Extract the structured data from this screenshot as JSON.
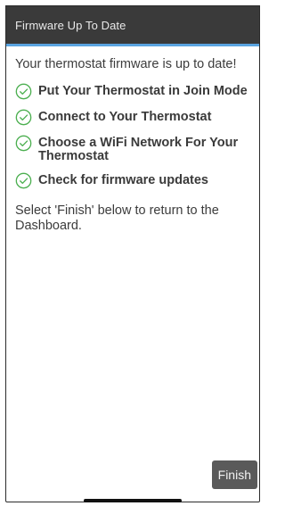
{
  "header": {
    "title": "Firmware Up To Date"
  },
  "main": {
    "status_text": "Your thermostat firmware is up to date!",
    "steps": [
      {
        "label": "Put Your Thermostat in Join Mode",
        "icon": "check-circle-icon"
      },
      {
        "label": "Connect to Your Thermostat",
        "icon": "check-circle-icon"
      },
      {
        "label": "Choose a WiFi Network For Your Thermostat",
        "icon": "check-circle-icon"
      },
      {
        "label": "Check for firmware updates",
        "icon": "check-circle-icon"
      }
    ],
    "instruction": "Select 'Finish' below to return to the Dashboard."
  },
  "footer": {
    "finish_label": "Finish"
  },
  "colors": {
    "header_bg": "#3a3a3a",
    "header_accent": "#5aa4e0",
    "check_green": "#4caf50",
    "button_bg": "#5a5a5a"
  }
}
